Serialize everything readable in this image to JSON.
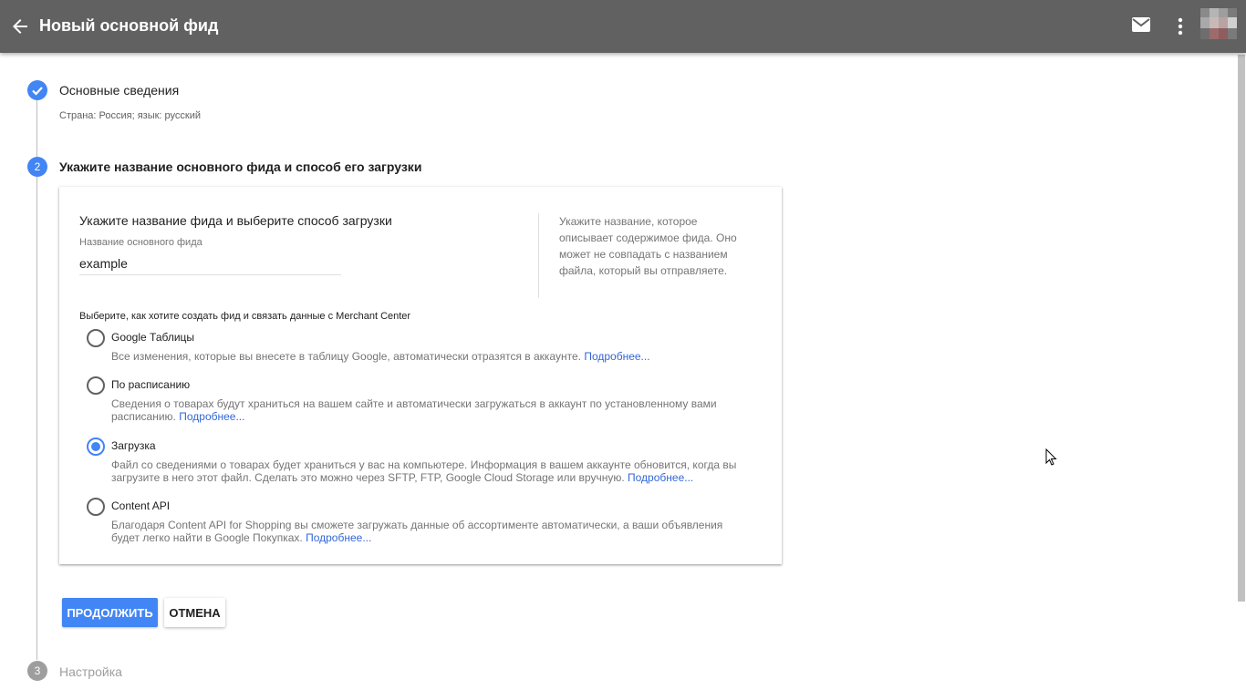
{
  "header": {
    "title": "Новый основной фид",
    "back_icon": "arrow-back-icon",
    "mail_icon": "mail-icon",
    "more_icon": "more-vert-icon"
  },
  "steps": {
    "step1": {
      "title": "Основные сведения",
      "summary": "Страна: Россия; язык: русский"
    },
    "step2": {
      "number": "2",
      "title": "Укажите название основного фида и способ его загрузки"
    },
    "step3": {
      "number": "3",
      "title": "Настройка"
    }
  },
  "card": {
    "heading": "Укажите название фида и выберите способ загрузки",
    "field_label": "Название основного фида",
    "field_value": "example",
    "help_text": "Укажите название, которое описывает содержимое фида. Оно может не совпадать с названием файла, который вы отправляете.",
    "choose_label": "Выберите, как хотите создать фид и связать данные с Merchant Center",
    "options": [
      {
        "title": "Google Таблицы",
        "desc": "Все изменения, которые вы внесете в таблицу Google, автоматически отразятся в аккаунте.",
        "link": "Подробнее...",
        "checked": false
      },
      {
        "title": "По расписанию",
        "desc": "Сведения о товарах будут храниться на вашем сайте и автоматически загружаться в аккаунт по установленному вами расписанию.",
        "link": "Подробнее...",
        "checked": false
      },
      {
        "title": "Загрузка",
        "desc": "Файл со сведениями о товарах будет храниться у вас на компьютере. Информация в вашем аккаунте обновится, когда вы загрузите в него этот файл. Сделать это можно через SFTP, FTP, Google Cloud Storage или вручную.",
        "link": "Подробнее...",
        "checked": true
      },
      {
        "title": "Content API",
        "desc": "Благодаря Content API for Shopping вы сможете загружать данные об ассортименте автоматически, а ваши объявления будет легко найти в Google Покупках.",
        "link": "Подробнее...",
        "checked": false
      }
    ]
  },
  "buttons": {
    "continue": "ПРОДОЛЖИТЬ",
    "cancel": "ОТМЕНА"
  },
  "colors": {
    "topbar": "#616161",
    "accent": "#4285f4",
    "link": "#3367d6"
  }
}
